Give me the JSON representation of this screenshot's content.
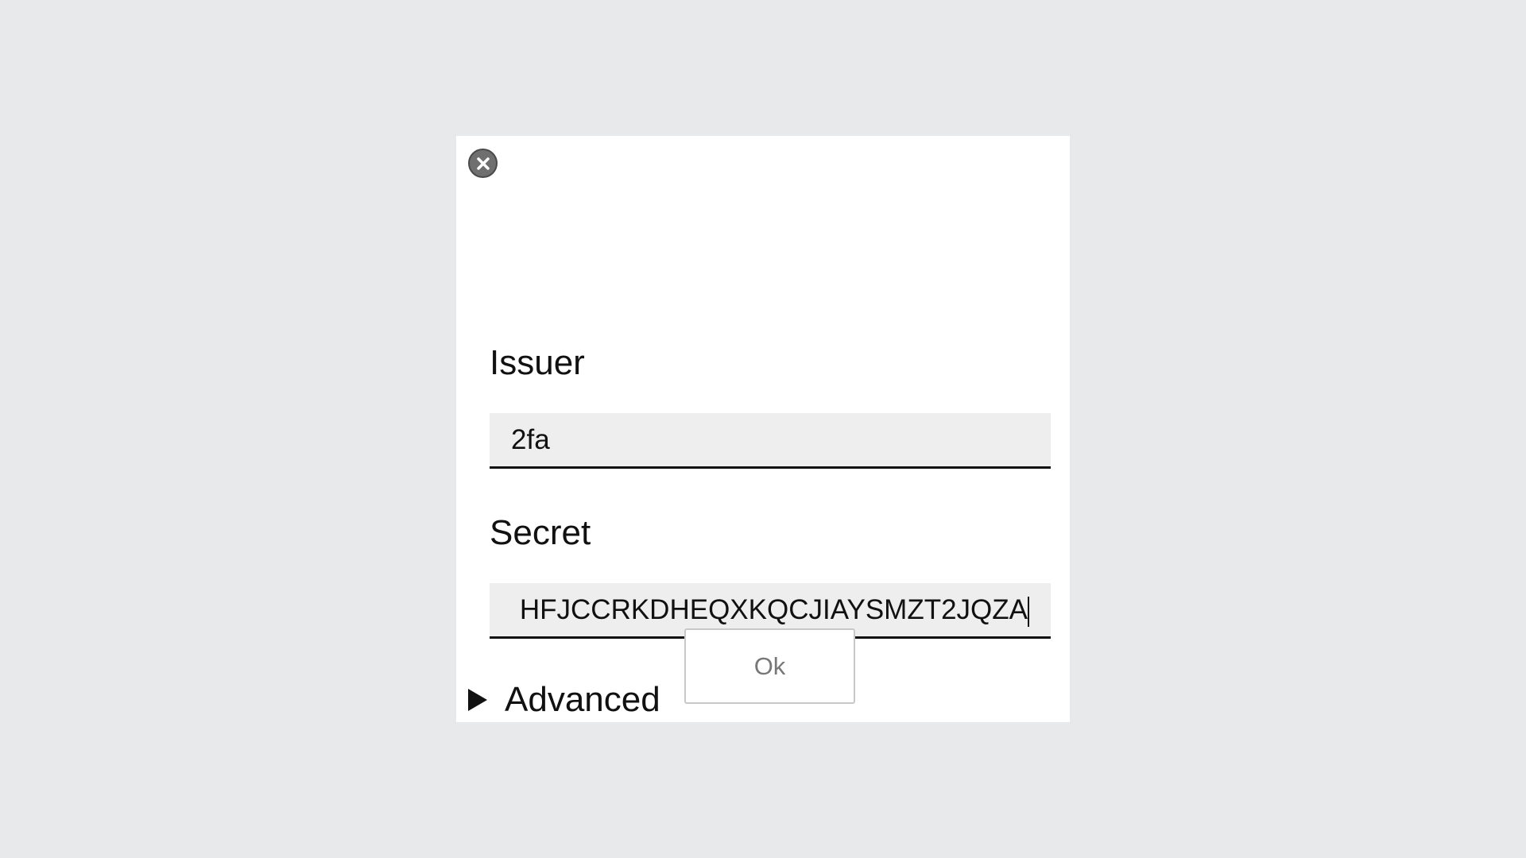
{
  "dialog": {
    "close_icon": "close-circle-icon",
    "issuer": {
      "label": "Issuer",
      "value": "2fa"
    },
    "secret": {
      "label": "Secret",
      "visible_value": "HFJCCRKDHEQXKQCJIAYSMZT2JQZA"
    },
    "advanced": {
      "label": "Advanced",
      "icon": "triangle-right-icon",
      "expanded": false
    },
    "ok_label": "Ok"
  },
  "colors": {
    "background": "#e8e9eb",
    "dialog": "#ffffff",
    "field_fill": "#eeeeee",
    "text": "#111111",
    "close_button": "#6f6f6f",
    "ok_text": "#777777"
  }
}
